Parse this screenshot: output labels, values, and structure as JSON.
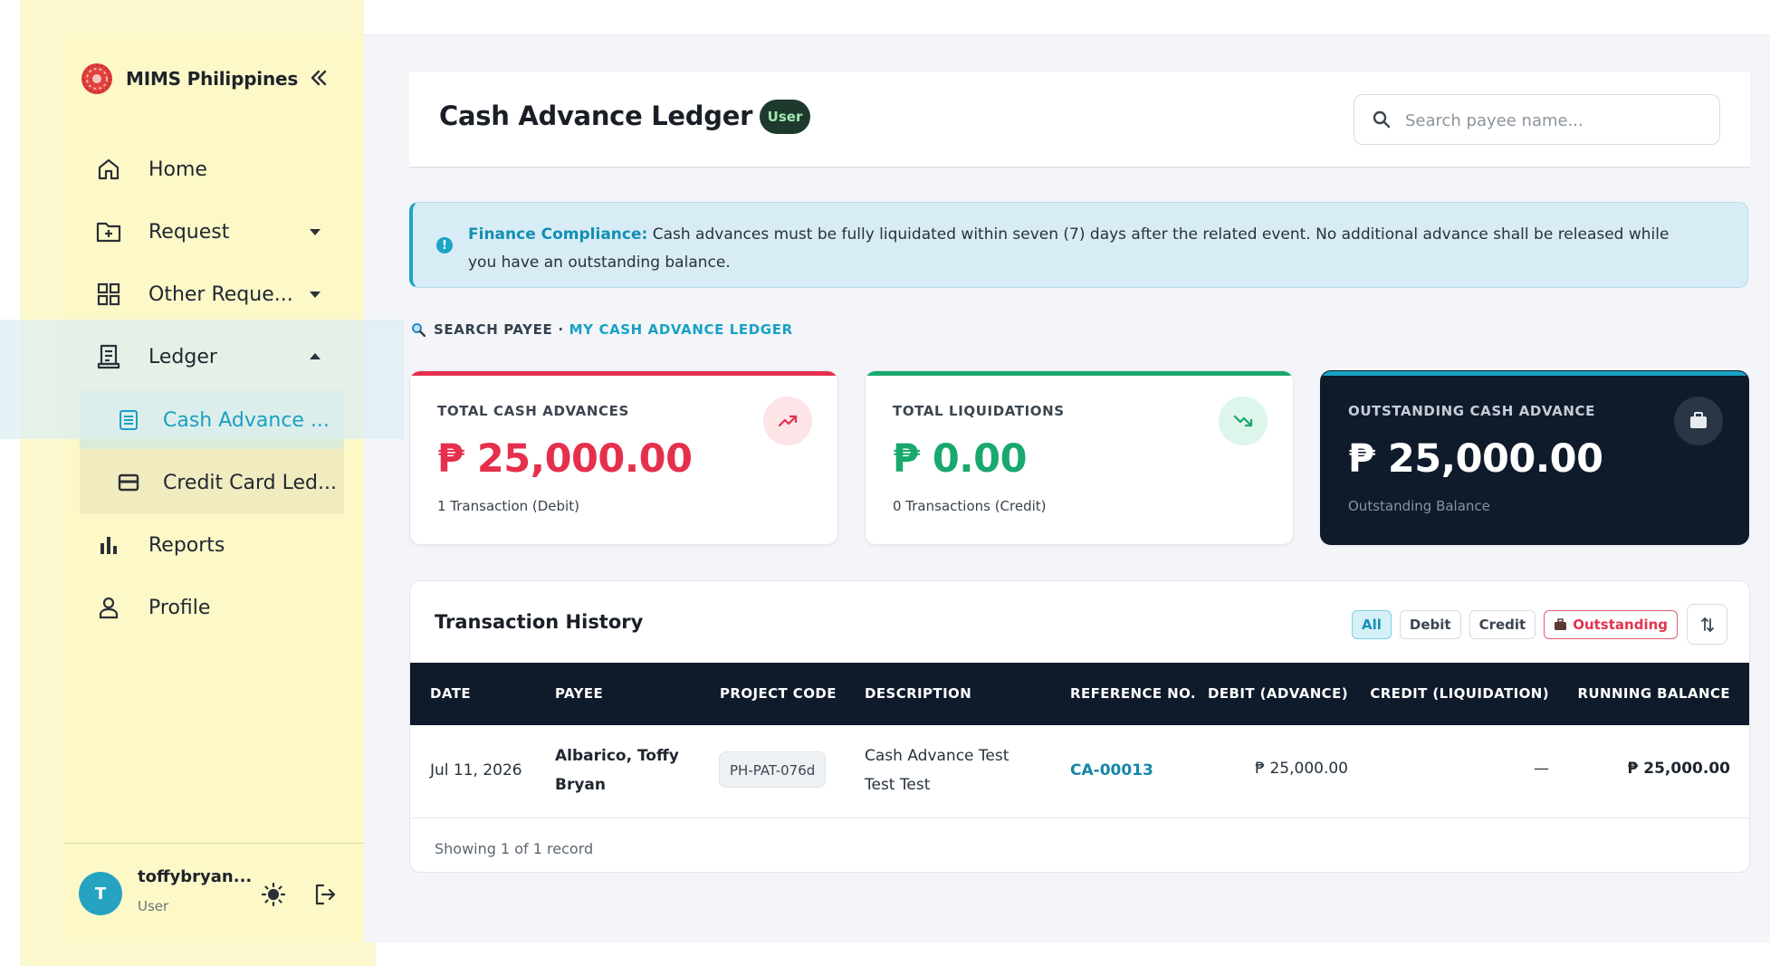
{
  "sidebar": {
    "brand": "MIMS Philippines",
    "items": [
      {
        "label": "Home",
        "icon": "home-icon"
      },
      {
        "label": "Request",
        "icon": "folder-plus-icon"
      },
      {
        "label": "Other Reque...",
        "icon": "grid-icon"
      },
      {
        "label": "Ledger",
        "icon": "receipt-icon"
      }
    ],
    "subitems": [
      {
        "label": "Cash Advance ...",
        "icon": "list-icon"
      },
      {
        "label": "Credit Card Led...",
        "icon": "credit-card-icon"
      }
    ],
    "bottom_items": [
      {
        "label": "Reports",
        "icon": "bar-chart-icon"
      },
      {
        "label": "Profile",
        "icon": "user-icon"
      }
    ],
    "user": {
      "initial": "T",
      "name": "toffybryan...",
      "role": "User"
    }
  },
  "header": {
    "title": "Cash Advance Ledger",
    "badge": "User",
    "search_placeholder": "Search payee name..."
  },
  "alert": {
    "label": "Finance Compliance:",
    "text": "Cash advances must be fully liquidated within seven (7) days after the related event. No additional advance shall be released while you have an outstanding balance."
  },
  "crumb": {
    "first": "SEARCH PAYEE",
    "separator": "·",
    "second": "MY CASH ADVANCE LEDGER"
  },
  "stats": [
    {
      "title": "TOTAL CASH ADVANCES",
      "value": "₱ 25,000.00",
      "sub": "1 Transaction (Debit)",
      "color": "#e5304d",
      "icon": "trending-up-icon"
    },
    {
      "title": "TOTAL LIQUIDATIONS",
      "value": "₱ 0.00",
      "sub": "0 Transactions (Credit)",
      "color": "#19a86e",
      "icon": "trending-down-icon"
    },
    {
      "title": "OUTSTANDING CASH ADVANCE",
      "value": "₱ 25,000.00",
      "sub": "Outstanding Balance",
      "color": "#1aa3c5",
      "icon": "briefcase-icon"
    }
  ],
  "table": {
    "title": "Transaction History",
    "filters": {
      "all": "All",
      "debit": "Debit",
      "credit": "Credit",
      "outstanding": "Outstanding"
    },
    "columns": [
      "DATE",
      "PAYEE",
      "PROJECT CODE",
      "DESCRIPTION",
      "REFERENCE NO.",
      "DEBIT (ADVANCE)",
      "CREDIT (LIQUIDATION)",
      "RUNNING BALANCE"
    ],
    "rows": [
      {
        "date": "Jul 11, 2026",
        "payee": "Albarico, Toffy Bryan",
        "project_code": "PH-PAT-076d",
        "description": "Cash Advance Test Test Test",
        "reference": "CA-00013",
        "debit": "₱ 25,000.00",
        "credit": "—",
        "balance": "₱ 25,000.00"
      }
    ],
    "footer": "Showing 1 of 1 record"
  }
}
